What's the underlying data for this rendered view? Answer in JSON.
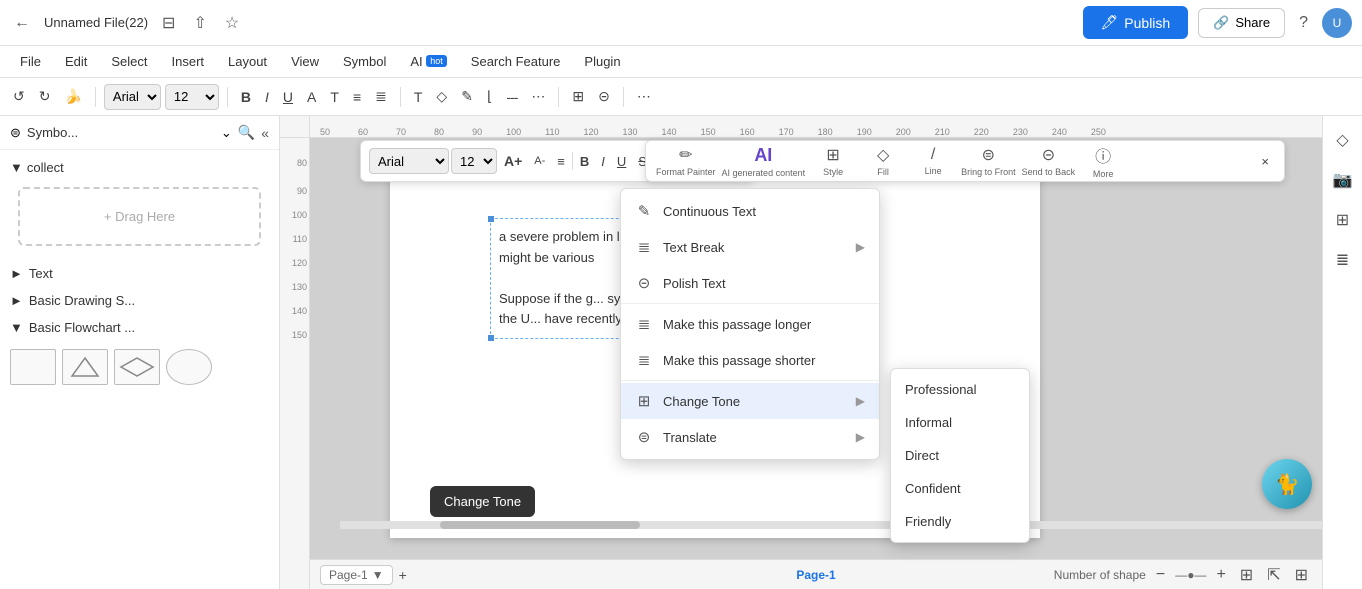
{
  "titleBar": {
    "title": "Unnamed File(22)",
    "publishLabel": "Publish",
    "shareLabel": "Share",
    "helpIcon": "?",
    "backIcon": "←",
    "bookmarkIcon": "⊟",
    "exportIcon": "↑",
    "starIcon": "☆"
  },
  "menuBar": {
    "items": [
      {
        "label": "File"
      },
      {
        "label": "Edit"
      },
      {
        "label": "Select"
      },
      {
        "label": "Insert"
      },
      {
        "label": "Layout"
      },
      {
        "label": "View"
      },
      {
        "label": "Symbol"
      },
      {
        "label": "AI",
        "badge": "hot"
      },
      {
        "label": "Search Feature"
      },
      {
        "label": "Plugin"
      }
    ]
  },
  "toolbar": {
    "undoLabel": "↺",
    "redoLabel": "↻",
    "paintLabel": "🖌",
    "fontFamily": "Arial",
    "fontSize": "12",
    "boldLabel": "B",
    "italicLabel": "I",
    "underlineLabel": "U",
    "fontColorLabel": "A",
    "baselineLabel": "T",
    "alignLabel": "≡",
    "alignRightLabel": "⊞",
    "textIcon": "T",
    "shapeIcon": "◇",
    "penIcon": "✏",
    "lineIcon": "⌐",
    "dashLineIcon": "---",
    "dotLineIcon": "···",
    "tableIcon": "⊞",
    "frameIcon": "⊡",
    "moreIcon": "···"
  },
  "sidebar": {
    "title": "Symbo...",
    "searchIcon": "🔍",
    "collapseIcon": "«",
    "panelIcon": "⊟",
    "collectSection": "collect",
    "dragHereText": "+ Drag Here",
    "items": [
      {
        "label": "Text"
      },
      {
        "label": "Basic Drawing S..."
      },
      {
        "label": "Basic Flowchart ..."
      }
    ],
    "subShapes": [
      "▷",
      "◇",
      "▷"
    ]
  },
  "floatToolbar": {
    "fontFamily": "Arial",
    "fontSize": "12",
    "increaseFontIcon": "A+",
    "decreaseFontIcon": "A-",
    "alignIcon": "≡",
    "boldLabel": "B",
    "italicLabel": "I",
    "underlineLabel": "U",
    "strikeLabel": "S̶",
    "listIcon": "☰",
    "listBullet": "•",
    "highlightLabel": "ab",
    "colorLabel": "A"
  },
  "rightIconRow": {
    "items": [
      {
        "icon": "✏",
        "label": "Format Painter"
      },
      {
        "icon": "AI",
        "label": "AI generated content"
      },
      {
        "icon": "⊠",
        "label": "Style"
      },
      {
        "icon": "◇",
        "label": "Fill"
      },
      {
        "icon": "/",
        "label": "Line"
      },
      {
        "icon": "⊟",
        "label": "Bring to Front"
      },
      {
        "icon": "⊞",
        "label": "Send to Back"
      },
      {
        "icon": "ⓘ",
        "label": "More"
      }
    ]
  },
  "contextMenu": {
    "items": [
      {
        "icon": "✎",
        "label": "Continuous Text",
        "arrow": false
      },
      {
        "icon": "☰",
        "label": "Text Break",
        "arrow": true
      },
      {
        "icon": "⊡",
        "label": "Polish Text",
        "arrow": false
      },
      {
        "icon": "☰",
        "label": "Make this passage longer",
        "arrow": false
      },
      {
        "icon": "☰",
        "label": "Make this passage shorter",
        "arrow": false
      },
      {
        "icon": "⊞",
        "label": "Change Tone",
        "arrow": true,
        "active": true
      },
      {
        "icon": "⊟",
        "label": "Translate",
        "arrow": true
      }
    ]
  },
  "subMenu": {
    "items": [
      {
        "label": "Professional"
      },
      {
        "label": "Informal"
      },
      {
        "label": "Direct"
      },
      {
        "label": "Confident"
      },
      {
        "label": "Friendly"
      }
    ]
  },
  "canvas": {
    "textContent": "a severe problem in launching successfully. There might be various",
    "textContent2": "Suppose if the g... system are outdat... missing, then the U... have recently upc... you may need to r...",
    "rulerLabels": [
      "50",
      "60",
      "70",
      "80",
      "90",
      "100",
      "110",
      "120",
      "130",
      "140",
      "150",
      "160",
      "170",
      "180",
      "190",
      "200",
      "210",
      "220",
      "230",
      "240",
      "250"
    ],
    "rulerVLabels": [
      "80",
      "90",
      "100",
      "110",
      "120",
      "130",
      "140",
      "150"
    ]
  },
  "changeToneTooltip": "Change Tone",
  "bottomBar": {
    "page1Label": "Page-1",
    "addPageLabel": "+",
    "statusLabel": "Number of shape",
    "pageActive": "Page-1"
  },
  "rightPanel": {
    "icons": [
      "◇",
      "📎",
      "▦",
      "⊞"
    ]
  },
  "zoom": {
    "zoomOutLabel": "−",
    "zoomInLabel": "+",
    "fitLabel": "⊡",
    "zoomValue": "—●—"
  }
}
